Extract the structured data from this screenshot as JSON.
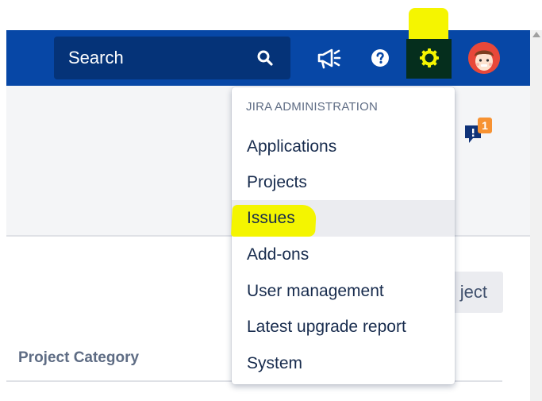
{
  "header": {
    "search_placeholder": "Search"
  },
  "icons": {
    "search": "search-icon",
    "announcements": "megaphone-icon",
    "help": "help-icon",
    "settings": "gear-icon",
    "profile": "avatar",
    "feedback": "feedback-icon"
  },
  "feedback": {
    "badge_count": "1"
  },
  "admin_menu": {
    "heading": "JIRA ADMINISTRATION",
    "items": [
      {
        "label": "Applications",
        "active": false
      },
      {
        "label": "Projects",
        "active": false
      },
      {
        "label": "Issues",
        "active": true
      },
      {
        "label": "Add-ons",
        "active": false
      },
      {
        "label": "User management",
        "active": false
      },
      {
        "label": "Latest upgrade report",
        "active": false
      },
      {
        "label": "System",
        "active": false
      }
    ]
  },
  "page": {
    "create_button_partial": "ject",
    "column_header": "Project Category"
  },
  "colors": {
    "topbar": "#0747a6",
    "highlight": "#f5f500",
    "badge": "#f79232",
    "avatar": "#e74c3c"
  }
}
